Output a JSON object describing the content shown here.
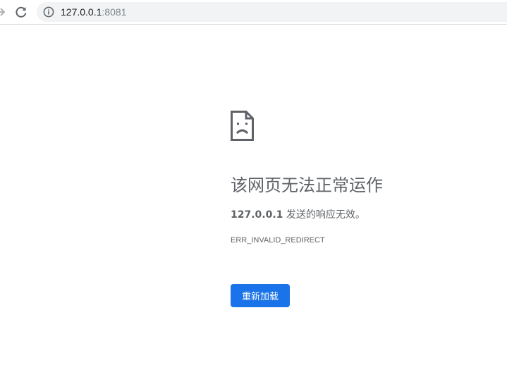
{
  "browser": {
    "url_host": "127.0.0.1",
    "url_port": ":8081"
  },
  "error_page": {
    "heading": "该网页无法正常运作",
    "host": "127.0.0.1",
    "description_suffix": " 发送的响应无效。",
    "error_code": "ERR_INVALID_REDIRECT",
    "reload_label": "重新加载"
  },
  "colors": {
    "primary_button": "#1a73e8",
    "text_gray": "#5f6368",
    "omnibox_bg": "#f1f3f4"
  },
  "icons": {
    "forward": "forward-arrow-icon",
    "reload": "reload-icon",
    "info": "info-icon",
    "error": "sad-page-icon"
  }
}
